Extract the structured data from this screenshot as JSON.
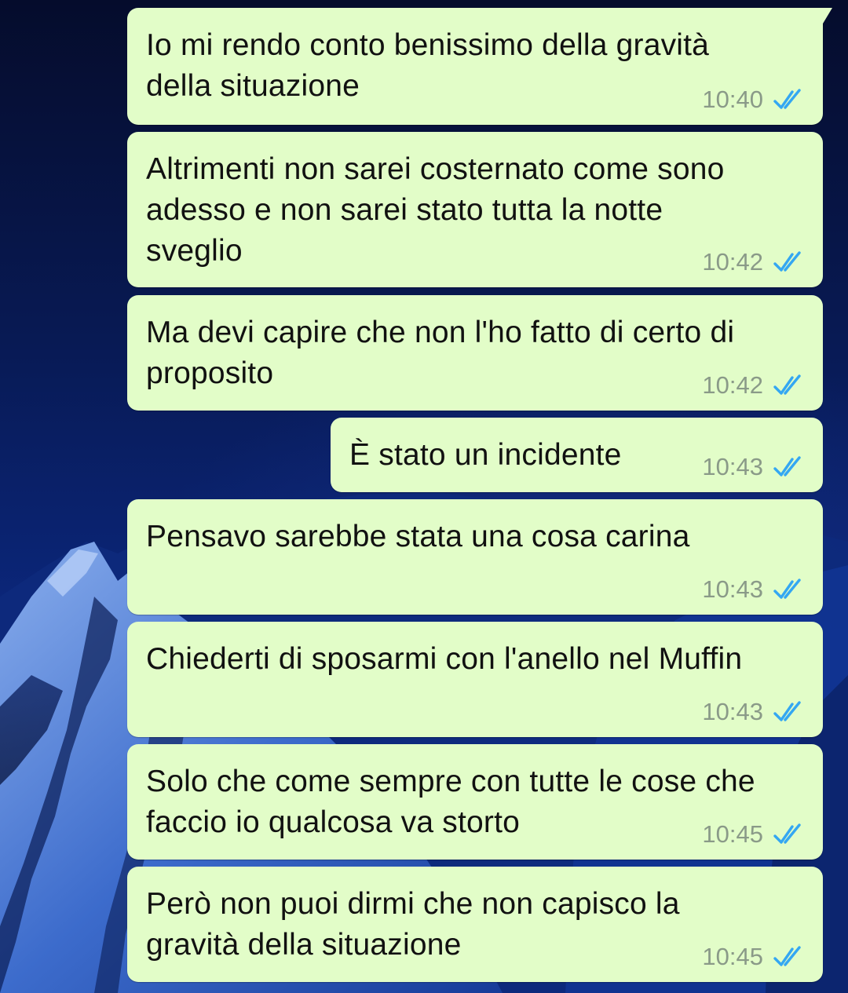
{
  "theme": {
    "bubble_color": "#e2fdc8",
    "tick_color": "#34a7f2",
    "time_color": "#8a9a88",
    "text_color": "#111111"
  },
  "messages": [
    {
      "text": "Io mi rendo conto benissimo della gravità della situazione",
      "time": "10:40",
      "status_icon": "double-check-read-icon"
    },
    {
      "text": "Altrimenti non sarei costernato come sono adesso e non sarei stato tutta la notte sveglio",
      "time": "10:42",
      "status_icon": "double-check-read-icon"
    },
    {
      "text": "Ma devi capire che non l'ho fatto di certo di proposito",
      "time": "10:42",
      "status_icon": "double-check-read-icon"
    },
    {
      "text": "È stato un incidente",
      "time": "10:43",
      "status_icon": "double-check-read-icon"
    },
    {
      "text": "Pensavo sarebbe stata una cosa carina",
      "time": "10:43",
      "status_icon": "double-check-read-icon"
    },
    {
      "text": "Chiederti di sposarmi con l'anello nel Muffin",
      "time": "10:43",
      "status_icon": "double-check-read-icon"
    },
    {
      "text": "Solo che come sempre con tutte le cose che faccio io qualcosa va storto",
      "time": "10:45",
      "status_icon": "double-check-read-icon"
    },
    {
      "text": "Però non puoi dirmi che non capisco la gravità della situazione",
      "time": "10:45",
      "status_icon": "double-check-read-icon"
    }
  ]
}
